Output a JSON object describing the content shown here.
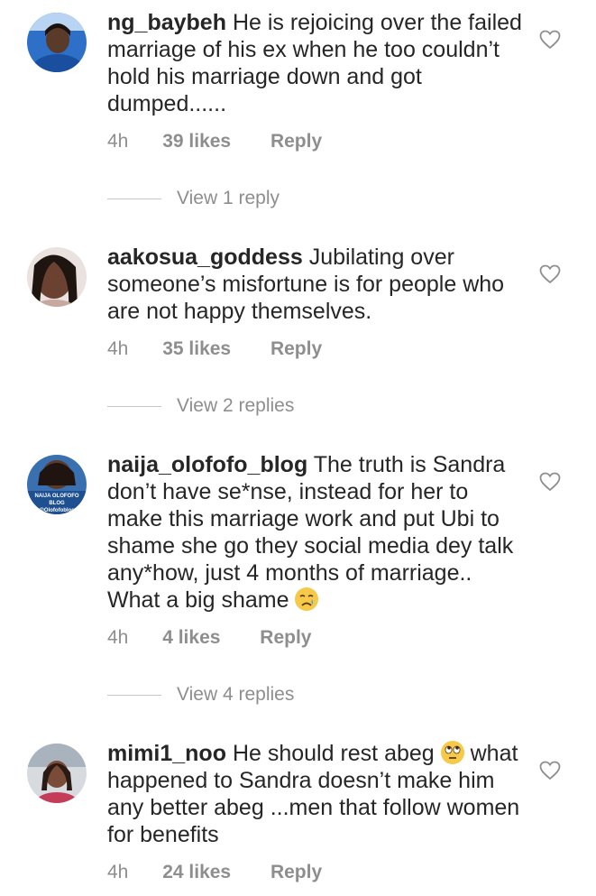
{
  "comments": [
    {
      "username": "ng_baybeh",
      "text": "He is rejoicing over the failed marriage of his ex when he too couldn’t hold his marriage down and got dumped......",
      "time": "4h",
      "likes": "39 likes",
      "reply": "Reply",
      "view_replies": "View 1 reply",
      "avatar_icon": "avatar"
    },
    {
      "username": "aakosua_goddess",
      "text": "Jubilating over someone’s misfortune is for people who are not happy themselves.",
      "time": "4h",
      "likes": "35 likes",
      "reply": "Reply",
      "view_replies": "View 2 replies",
      "avatar_icon": "avatar"
    },
    {
      "username": "naija_olofofo_blog",
      "text": "The truth is Sandra don’t have se*nse, instead for her to make this marriage work and put Ubi to shame she go they social media dey talk any*how, just 4 months of marriage.. What a big shame",
      "emoji": "crying-face",
      "time": "4h",
      "likes": "4 likes",
      "reply": "Reply",
      "view_replies": "View 4 replies",
      "avatar_icon": "avatar",
      "avatar_text_1": "NAIJA OLOFOFO BLOG",
      "avatar_text_2": "@Olofofoblog"
    },
    {
      "username": "mimi1_noo",
      "text_part1": "He should rest abeg",
      "emoji": "eye-roll-face",
      "text_part2": "what happened to Sandra doesn’t make him any better abeg ...men that follow women for benefits",
      "time": "4h",
      "likes": "24 likes",
      "reply": "Reply",
      "avatar_icon": "avatar"
    }
  ],
  "icons": {
    "like": "heart-outline-icon"
  },
  "colors": {
    "text": "#262626",
    "muted": "#8e8e8e",
    "divider": "#c7c7c7"
  }
}
